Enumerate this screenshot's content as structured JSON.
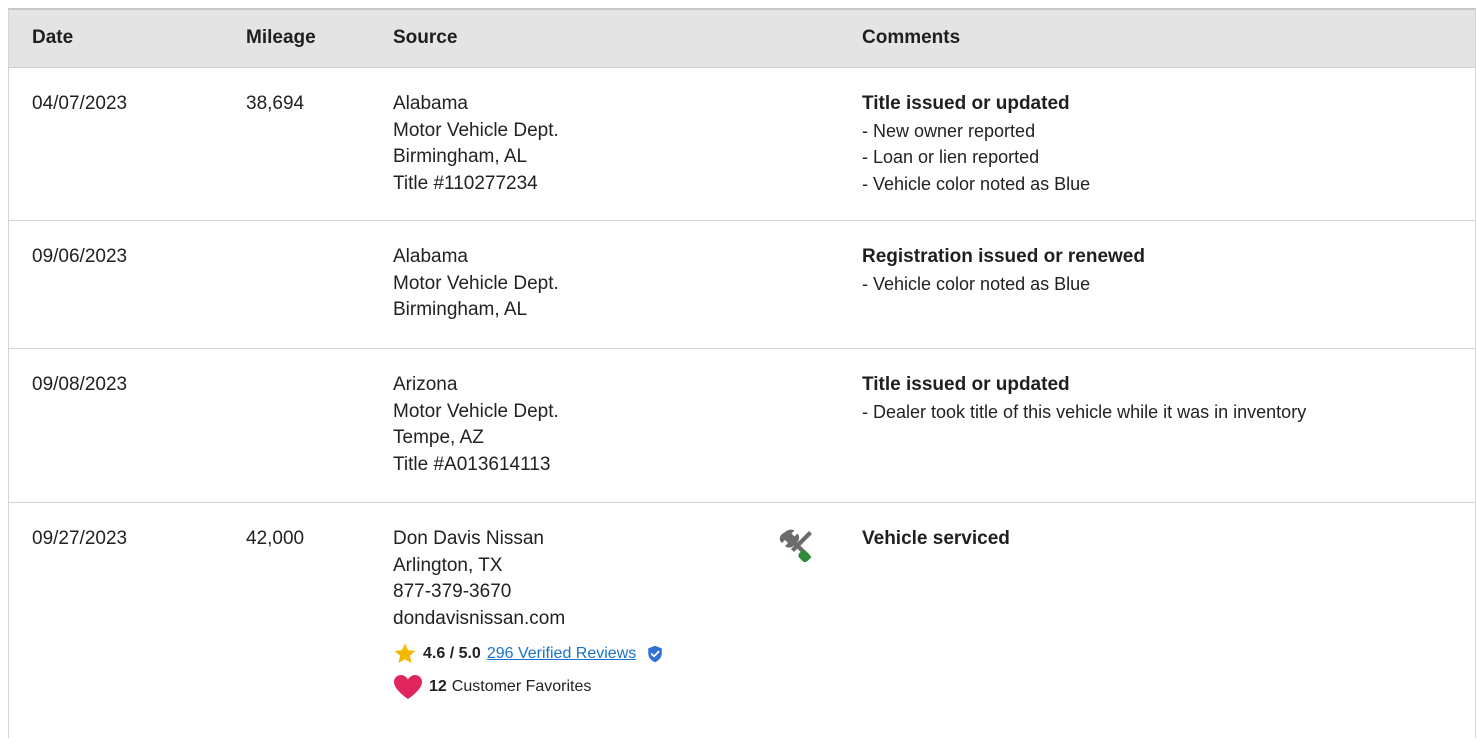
{
  "table": {
    "headers": {
      "date": "Date",
      "mileage": "Mileage",
      "source": "Source",
      "comments": "Comments"
    },
    "rows": [
      {
        "date": "04/07/2023",
        "mileage": "38,694",
        "source": [
          "Alabama",
          "Motor Vehicle Dept.",
          "Birmingham, AL",
          "Title #110277234"
        ],
        "headline": "Title issued or updated",
        "details": [
          "- New owner reported",
          "- Loan or lien reported",
          "- Vehicle color noted as Blue"
        ]
      },
      {
        "date": "09/06/2023",
        "mileage": "",
        "source": [
          "Alabama",
          "Motor Vehicle Dept.",
          "Birmingham, AL"
        ],
        "headline": "Registration issued or renewed",
        "details": [
          "- Vehicle color noted as Blue"
        ]
      },
      {
        "date": "09/08/2023",
        "mileage": "",
        "source": [
          "Arizona",
          "Motor Vehicle Dept.",
          "Tempe, AZ",
          "Title #A013614113"
        ],
        "headline": "Title issued or updated",
        "details": [
          "- Dealer took title of this vehicle while it was in inventory"
        ]
      },
      {
        "date": "09/27/2023",
        "mileage": "42,000",
        "source": [
          "Don Davis Nissan",
          "Arlington, TX",
          "877-379-3670",
          "dondavisnissan.com"
        ],
        "rating": {
          "score": "4.6 / 5.0",
          "reviews_link": "296 Verified Reviews"
        },
        "favorites": {
          "count": "12",
          "label": "Customer Favorites"
        },
        "headline": "Vehicle serviced",
        "details": []
      }
    ]
  },
  "icons": {
    "service": "wrench-screwdriver-icon",
    "rating": "star-icon",
    "verified": "verified-shield-icon",
    "favorites": "heart-icon"
  },
  "colors": {
    "header_bg": "#e4e4e4",
    "link": "#1a73c8",
    "star": "#f5b800",
    "heart": "#e0245e",
    "verified": "#2f6fd6",
    "service_handle": "#2e8b3a",
    "service_tool": "#6b6b6b"
  }
}
